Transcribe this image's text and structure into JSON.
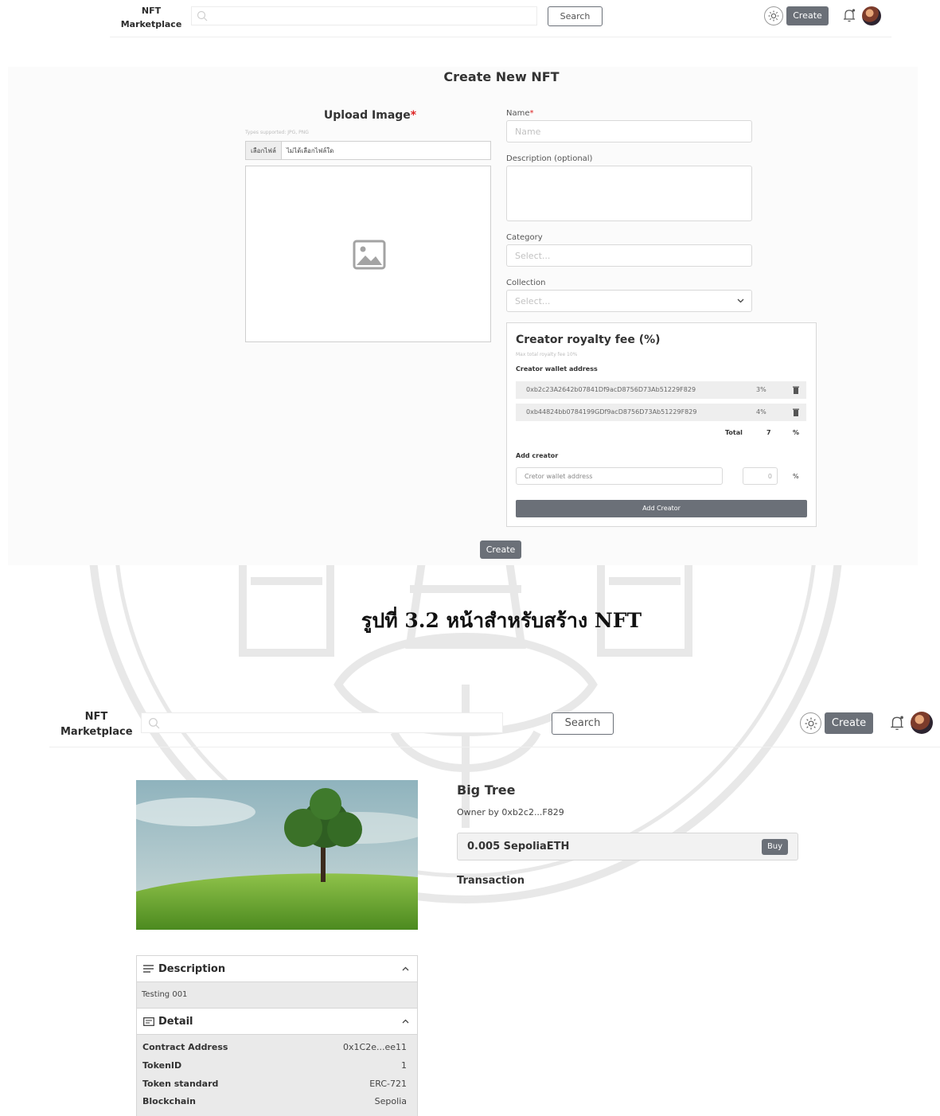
{
  "navbar": {
    "brand_line1": "NFT",
    "brand_line2": "Marketplace",
    "search_button": "Search",
    "create_button": "Create"
  },
  "create_page": {
    "title": "Create New NFT",
    "upload_title": "Upload Image",
    "required_mark": "*",
    "types_hint": "Types supported: JPG, PNG",
    "file_button": "เลือกไฟล์",
    "file_status": "ไม่ได้เลือกไฟล์ใด",
    "name_label": "Name",
    "name_placeholder": "Name",
    "description_label": "Description (optional)",
    "category_label": "Category",
    "category_placeholder": "Select...",
    "collection_label": "Collection",
    "collection_placeholder": "Select...",
    "royalty_title": "Creator royalty fee (%)",
    "royalty_hint": "Max total royalty fee 10%",
    "wallet_label": "Creator wallet address",
    "creators": [
      {
        "address": "0xb2c23A2642b07841Df9acD8756D73Ab51229F829",
        "percent": "3%"
      },
      {
        "address": "0xb44824bb0784199GDf9acD8756D73Ab51229F829",
        "percent": "4%"
      }
    ],
    "total_label": "Total",
    "total_value": "7",
    "total_unit": "%",
    "add_creator_label": "Add creator",
    "add_wallet_placeholder": "Cretor wallet address",
    "add_percent_value": "0",
    "add_percent_unit": "%",
    "add_creator_button": "Add Creator",
    "submit_button": "Create"
  },
  "caption": "รูปที่ 3.2 หน้าสำหรับสร้าง NFT",
  "detail_page": {
    "nft_name": "Big Tree",
    "owner_text": "Owner by 0xb2c2...F829",
    "price": "0.005 SepoliaETH",
    "buy_button": "Buy",
    "transaction_label": "Transaction",
    "description_title": "Description",
    "description_text": "Testing 001",
    "detail_title": "Detail",
    "details": [
      {
        "key": "Contract Address",
        "value": "0x1C2e...ee11"
      },
      {
        "key": "TokenID",
        "value": "1"
      },
      {
        "key": "Token standard",
        "value": "ERC-721"
      },
      {
        "key": "Blockchain",
        "value": "Sepolia"
      }
    ]
  },
  "colors": {
    "button_dark": "#6b7078",
    "required": "#dd2222",
    "panel_gray": "#eaeaea"
  }
}
